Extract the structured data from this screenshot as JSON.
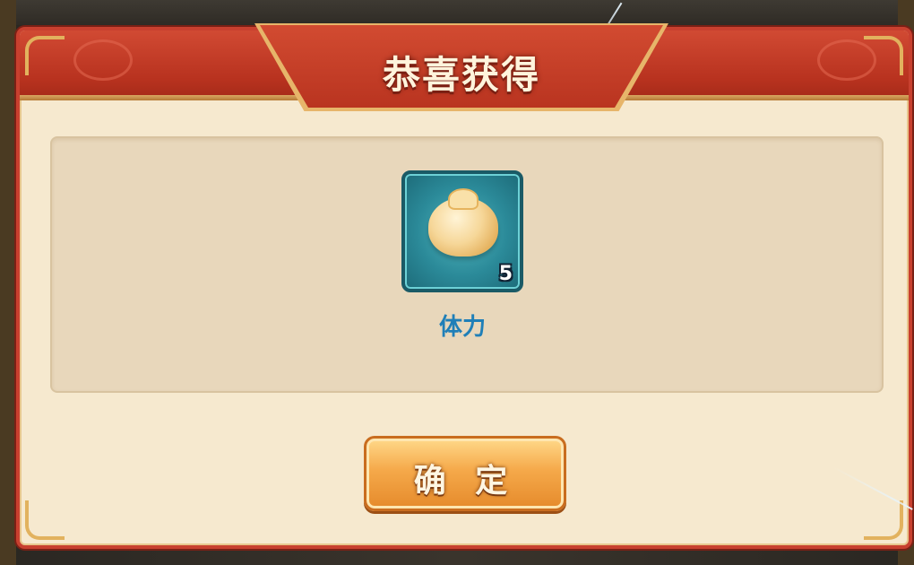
{
  "dialog": {
    "title": "恭喜获得",
    "accent_color": "#c8402f",
    "panel_color": "#f6e9cf"
  },
  "reward": {
    "icon": "steamed-bun-icon",
    "name": "体力",
    "count": "5",
    "name_color": "#1f7fb8"
  },
  "actions": {
    "confirm_label": "确 定"
  }
}
